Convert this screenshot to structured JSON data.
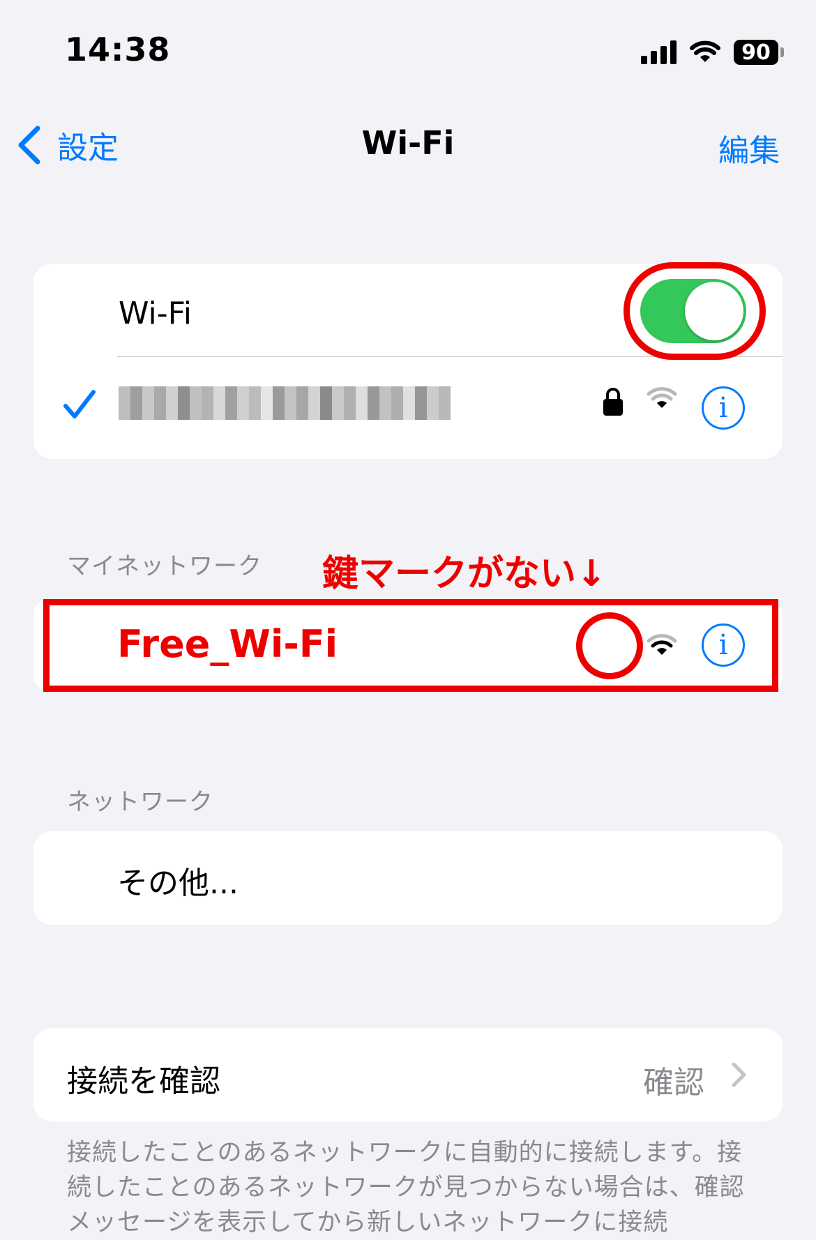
{
  "status_bar": {
    "time": "14:38",
    "battery": "90"
  },
  "nav": {
    "back_label": "設定",
    "title": "Wi-Fi",
    "edit_label": "編集"
  },
  "wifi_card": {
    "wifi_label": "Wi-Fi",
    "wifi_enabled": true
  },
  "my_networks": {
    "header": "マイネットワーク",
    "annotation": "鍵マークがない↓",
    "network_name": "Free_Wi-Fi"
  },
  "networks": {
    "header": "ネットワーク",
    "other_label": "その他..."
  },
  "confirm": {
    "label": "接続を確認",
    "value": "確認",
    "footer": "接続したことのあるネットワークに自動的に接続します。接続したことのあるネットワークが見つからない場合は、確認メッセージを表示してから新しいネットワークに接続"
  },
  "colors": {
    "accent": "#007aff",
    "toggle_on": "#34c759",
    "annotation": "#ee0000"
  }
}
